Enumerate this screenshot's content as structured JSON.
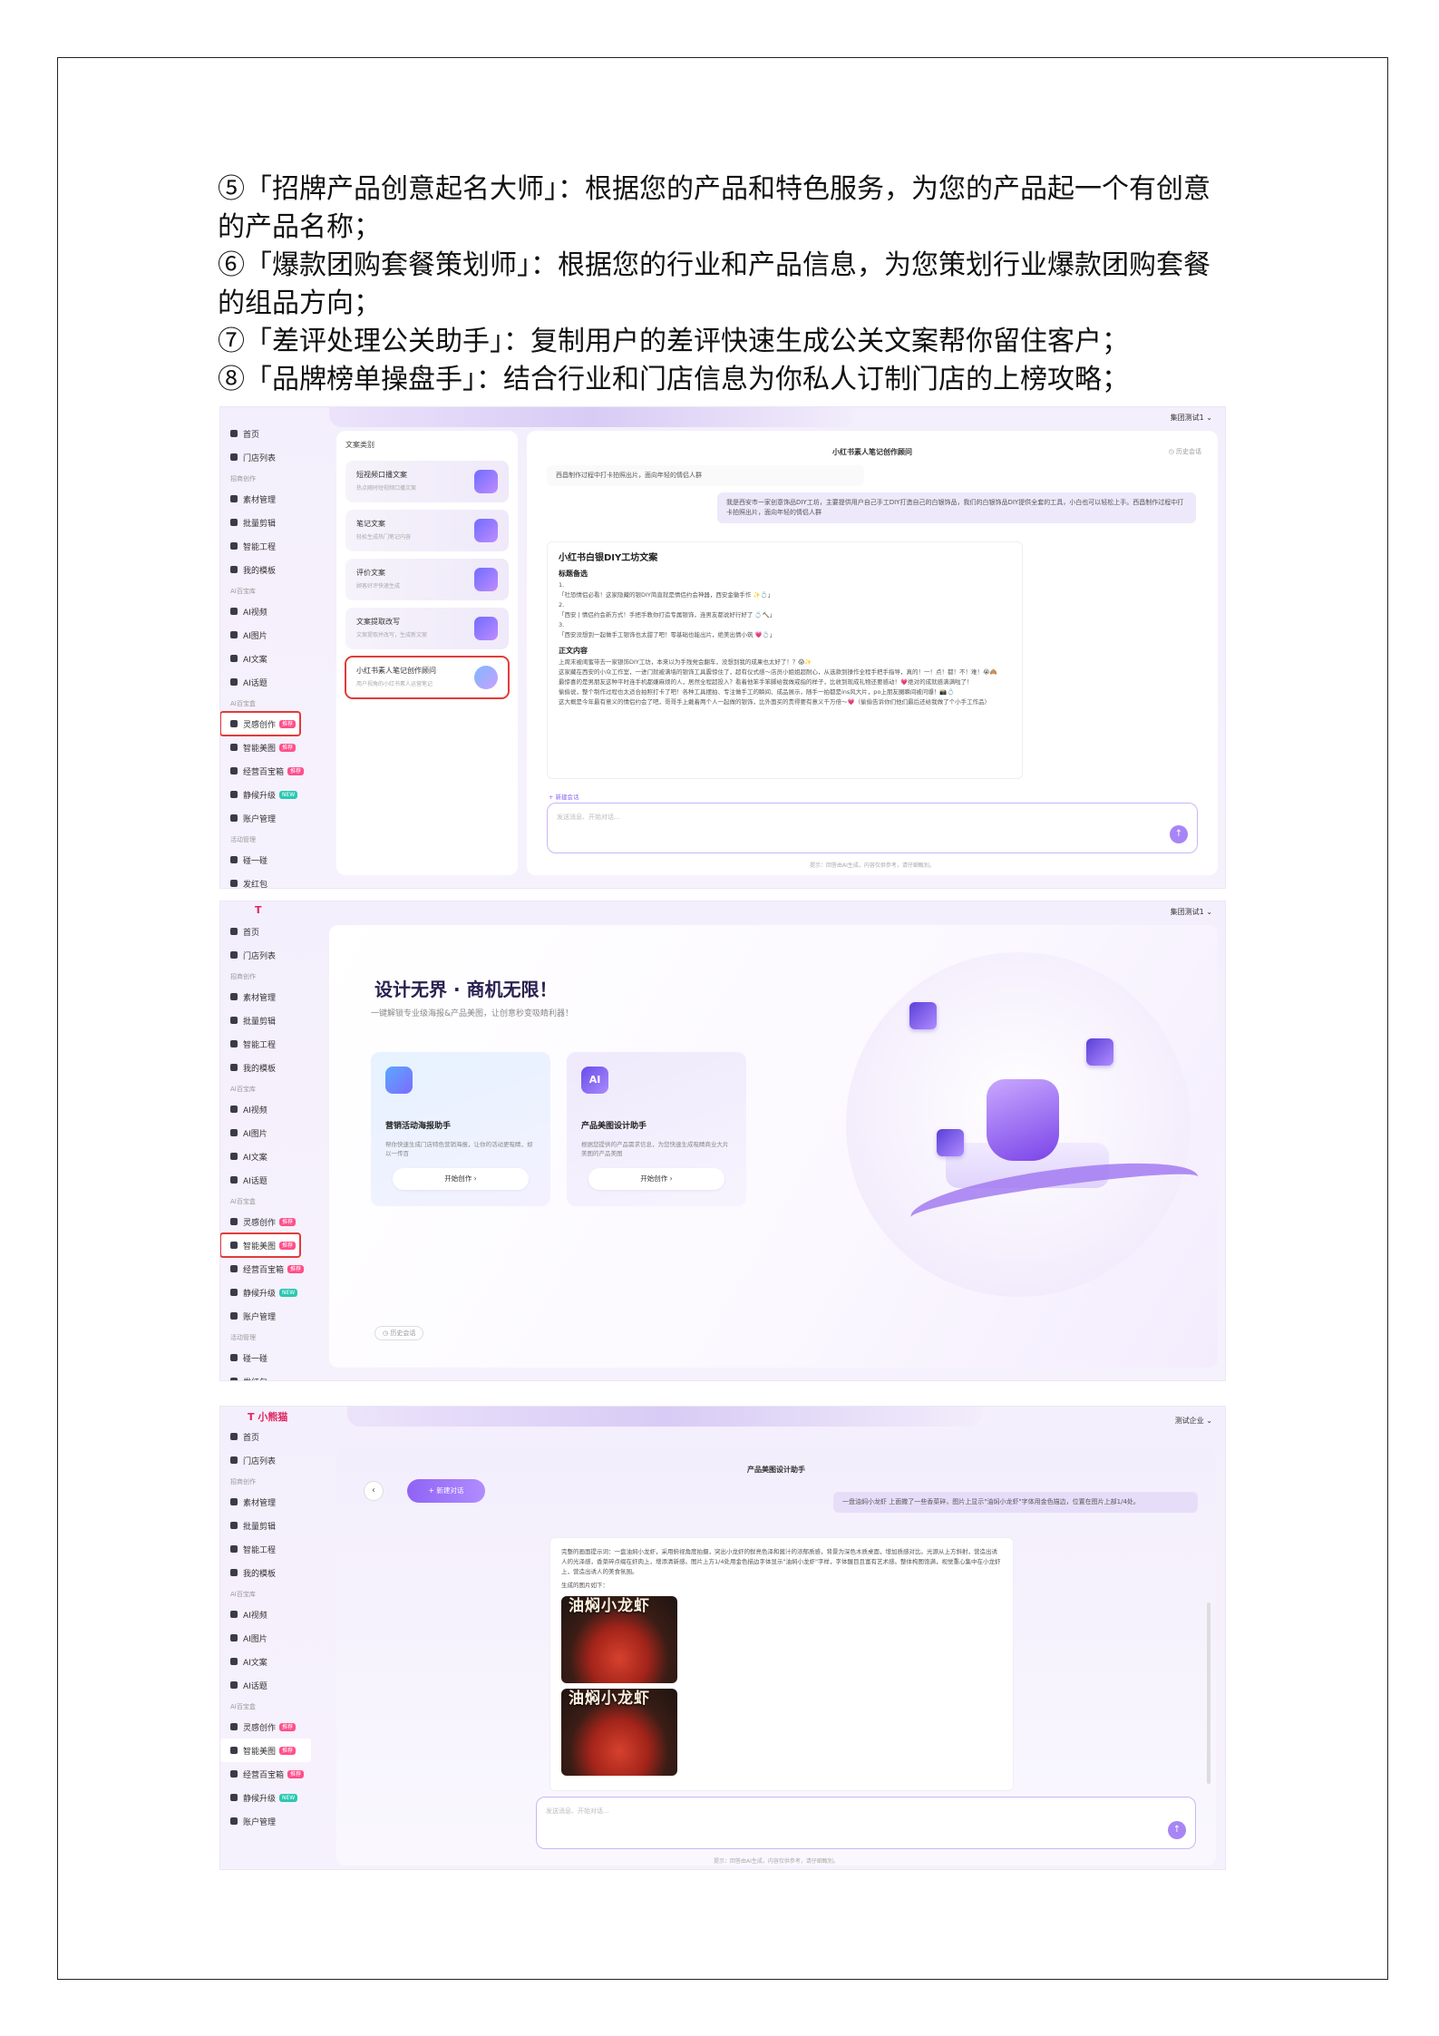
{
  "paragraphs": [
    "⑤「招牌产品创意起名大师」：根据您的产品和特色服务，为您的产品起一个有创意的产品名称；",
    "⑥「爆款团购套餐策划师」：根据您的行业和产品信息，为您策划行业爆款团购套餐的组品方向；",
    "⑦「差评处理公关助手」：复制用户的差评快速生成公关文案帮你留住客户；",
    "⑧「品牌榜单操盘手」：结合行业和门店信息为你私人订制门店的上榜攻略；"
  ],
  "sidebar": {
    "home": "首页",
    "stores": "门店列表",
    "group_create": "招商创作",
    "materials": "素材管理",
    "batch_edit": "批量剪辑",
    "smart_project": "智能工程",
    "my_templates": "我的模板",
    "group_ai": "AI百宝库",
    "ai_video": "AI视频",
    "ai_image": "AI图片",
    "ai_copy": "AI文案",
    "ai_topic": "AI话题",
    "group_ai2": "AI百宝盒",
    "inspiration": "灵感创作",
    "smart_design": "智能美图",
    "ops_box": "经营百宝箱",
    "quiet_upgrade": "静候升级",
    "account": "账户管理",
    "group_activity": "活动管理",
    "draw": "碰一碰",
    "red_packet": "发红包",
    "badge_hot": "推荐",
    "badge_new": "NEW"
  },
  "screen1": {
    "user": "集团测试1 ⌄",
    "category_label": "文案类别",
    "cards": [
      {
        "title": "短视频口播文案",
        "sub": "热点随时短视频口播文案"
      },
      {
        "title": "笔记文案",
        "sub": "轻松生成热门笔记内容"
      },
      {
        "title": "评价文案",
        "sub": "顾客好评快速生成"
      },
      {
        "title": "文案提取改写",
        "sub": "文案提取并改写，生成新文案"
      },
      {
        "title": "小红书素人笔记创作顾问",
        "sub": "用户视角的小红书素人运营笔记"
      }
    ],
    "chat_title": "小红书素人笔记创作顾问",
    "history": "◷ 历史会话",
    "bubble1": "西昌制作过程中打卡拍照出片，面向年轻的情侣人群",
    "user_msg": "我是西安市一家创意饰品DIY工坊，主要提供用户自己手工DIY打造自己的白银饰品，我们的白银饰品DIY提供全套的工具，小白也可以轻松上手。西昌制作过程中打卡拍照出片，面向年轻的情侣人群",
    "answer_title": "小红书白银DIY工坊文案",
    "answer_sub1": "标题备选",
    "answer_lines": [
      "1.",
      "「社恐情侣必看！这家隐藏的银DIY简直就是情侣约会神器，西安金徽手作 ✨💍」",
      "2.",
      "「西安 | 情侣约会新方式！手把手教你打造专属银饰，连男友都说好行好了 💍🔨」",
      "3.",
      "「西安没想到一起做手工银饰也太甜了吧！零基础也能出片，绝美出情小筑 💗💍」"
    ],
    "answer_sub2": "正文内容",
    "body_lines": [
      "上周末被闺蜜带去一家银饰DIY工坊，本来以为手残党会翻车，没想到我的成果也太好了！？😱✨",
      "这家藏在西安的小众工作室，一进门就被满墙的银饰工具震惊住了，超有仪式感～店员小姐姐超耐心，从选款到操作全程手把手指导，真的！一！点！都！不！难！😭🙈",
      "最惊喜的是男朋友这种平时连手机都嫌麻烦的人，居然全程超投入？看着他笨手笨脚给我做戒指的样子，比收到现成礼物还要感动！💗绝对的成就感满满啦了！",
      "偷偷说，整个制作过程也太适合拍照打卡了吧！各种工具摆拍、专注做手工的瞬间、成品展示，随手一拍都是ins风大片，po上朋友圈瞬间被问爆！📸💍",
      "这大概是今年最有意义的情侣约会了吧，哥哥手上戴着两个人一起做的银饰，比外面买的贵得要有意义千万倍～💗（偷偷告诉你们他们最后还给我做了个小手工作品）"
    ],
    "new_session": "+ 新建会话",
    "input_placeholder": "发送消息、开始对话...",
    "tip": "提示：回答由AI生成，内容仅供参考，请仔细甄别。"
  },
  "screen2": {
    "user": "集团测试1 ⌄",
    "hero_title": "设计无界 · 商机无限！",
    "hero_sub": "一键解锁专业级海报&产品美图，让创意秒变吸睛利器！",
    "card1_title": "营销活动海报助手",
    "card1_sub": "帮你快速生成门店特色营销海报，让你的活动更吸睛，却以一传百",
    "card1_btn": "开始创作 ›",
    "card2_title": "产品美图设计助手",
    "card2_sub": "根据您提供的产品需求信息，为您快速生成吸睛商业大片美图的产品美图",
    "card2_btn": "开始创作 ›",
    "card2_icon": "AI",
    "history": "◷ 历史会话"
  },
  "screen3": {
    "logo": "T 小熊猫",
    "user": "测试企业 ⌄",
    "new_chat": "+ 新建对话",
    "chat_title": "产品美图设计助手",
    "user_msg": "一盘油焖小龙虾 上面撒了一些香菜碎，图片上显示\"油焖小龙虾\"字体用金色描边，位置在图片上部1/4处。",
    "answer_text": "完整的画面提示词：一盘油焖小龙虾，采用俯视角度拍摄，突出小龙虾的鲜亮色泽和酱汁的浓郁质感，背景为深色木质桌面，增加质感对比。光源从上方斜射，营造出诱人的光泽感，香菜碎点缀在虾肉上，增添清新感。图片上方1/4处用金色描边字体显示\"油焖小龙虾\"字样，字体醒目且富有艺术感。整体构图饱满，视觉重心集中在小龙虾上，营造出诱人的美食氛围。",
    "generated_label": "生成的图片如下：",
    "image_caption": "油焖小龙虾",
    "input_placeholder": "发送消息、开始对话...",
    "tip": "提示：回答由AI生成，内容仅供参考，请仔细甄别。"
  }
}
